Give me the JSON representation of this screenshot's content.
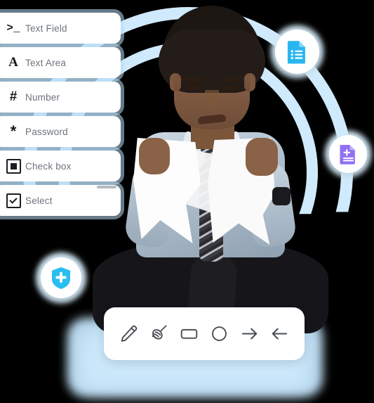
{
  "scene": {
    "title": "Form field types panel with drawing toolbar",
    "background_color": "#000000"
  },
  "decor": {
    "arc_color": "#cfeafc",
    "glow_color": "#bfe0f7",
    "arcs": [
      "outer-arc",
      "inner-arc"
    ]
  },
  "field_list": {
    "name": "form-field-types",
    "scrollbar_visible": true,
    "items": [
      {
        "icon": "terminal-prompt-icon",
        "glyph": ">_",
        "label": "Text Field"
      },
      {
        "icon": "serif-letter-a-icon",
        "glyph": "A",
        "label": "Text Area"
      },
      {
        "icon": "hash-icon",
        "glyph": "#",
        "label": "Number"
      },
      {
        "icon": "asterisk-icon",
        "glyph": "*",
        "label": "Password"
      },
      {
        "icon": "filled-square-box-icon",
        "glyph": "",
        "label": "Check box"
      },
      {
        "icon": "checkmark-box-icon",
        "glyph": "",
        "label": "Select"
      }
    ]
  },
  "badges": [
    {
      "name": "document-list-badge",
      "icon": "document-list-icon",
      "color": "#29b6f0"
    },
    {
      "name": "document-add-badge",
      "icon": "document-plus-icon",
      "color": "#9170f2"
    },
    {
      "name": "shield-protect-badge",
      "icon": "shield-plus-icon",
      "color": "#29bdf2"
    }
  ],
  "toolbar": {
    "name": "drawing-toolbar",
    "icon_color": "#4a4f55",
    "tools": [
      {
        "name": "pencil-tool",
        "icon": "pencil-icon"
      },
      {
        "name": "eraser-tool",
        "icon": "broom-icon"
      },
      {
        "name": "rectangle-tool",
        "icon": "rectangle-icon"
      },
      {
        "name": "ellipse-tool",
        "icon": "circle-icon"
      },
      {
        "name": "redo-tool",
        "icon": "arrow-right-icon"
      },
      {
        "name": "undo-tool",
        "icon": "arrow-left-icon"
      }
    ]
  },
  "photo": {
    "name": "man-tearing-paper-photo",
    "description": "Man in light blue dress shirt and striped tie tearing a sheet of paper, seated cross-legged"
  }
}
